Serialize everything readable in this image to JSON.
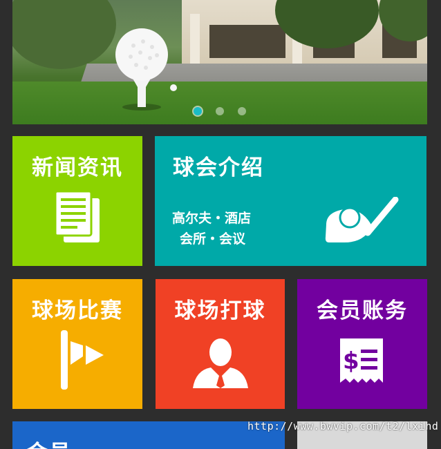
{
  "banner": {
    "slide_count": 3,
    "active_slide": 1
  },
  "tiles": {
    "news": {
      "title": "新闻资讯",
      "color": "#8cd300",
      "icon": "document-icon"
    },
    "club": {
      "title": "球会介绍",
      "line1": "高尔夫・酒店",
      "line2": "会所・会议",
      "color": "#00a9a8",
      "icon": "golf-club-icon"
    },
    "match": {
      "title": "球场比赛",
      "color": "#f6ad00",
      "icon": "flag-icon"
    },
    "play": {
      "title": "球场打球",
      "color": "#f04125",
      "icon": "golfer-icon"
    },
    "account": {
      "title": "会员账务",
      "color": "#72009f",
      "icon": "receipt-icon"
    },
    "bottom_left": {
      "title": "会员...",
      "color": "#1b66c9"
    },
    "bottom_right": {
      "color": "#d9d9d9"
    }
  },
  "watermark": "http://www.bwvip.com/t2/lxihd"
}
